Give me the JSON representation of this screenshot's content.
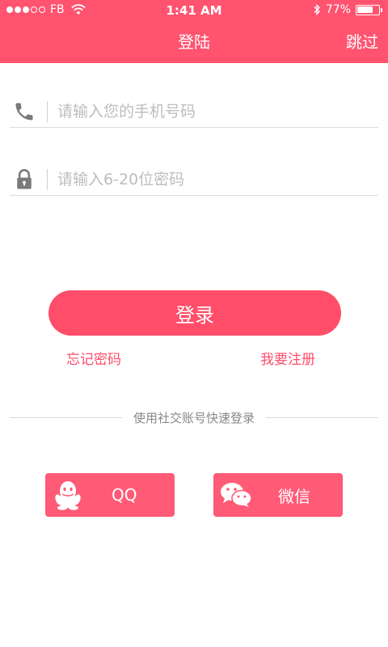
{
  "status_bar": {
    "carrier": "FB",
    "time": "1:41 AM",
    "battery": "77%",
    "battery_level": 0.77
  },
  "nav": {
    "title": "登陆",
    "skip_label": "跳过"
  },
  "form": {
    "phone_placeholder": "请输入您的手机号码",
    "password_placeholder": "请输入6-20位密码"
  },
  "actions": {
    "login_label": "登录",
    "forgot_label": "忘记密码",
    "register_label": "我要注册"
  },
  "social": {
    "divider_text": "使用社交账号快速登录",
    "qq_label": "QQ",
    "wechat_label": "微信"
  },
  "colors": {
    "accent": "#ff5370",
    "button": "#ff4d6a",
    "placeholder": "#bdbdbd"
  },
  "icons": {
    "phone": "phone-icon",
    "lock": "lock-icon",
    "qq": "qq-penguin-icon",
    "wechat": "wechat-icon"
  }
}
